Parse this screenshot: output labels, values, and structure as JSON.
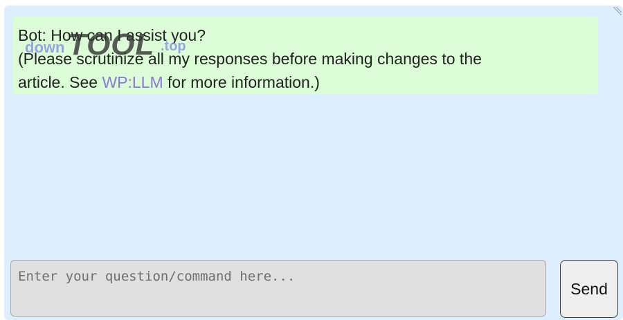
{
  "chat": {
    "messages": [
      {
        "line1": "Bot: How can I assist you?",
        "line2": "(Please scrutinize all my responses before making changes to the",
        "line3_prefix": "article. See ",
        "line3_link": "WP:LLM",
        "line3_suffix": " for more information.)"
      }
    ]
  },
  "watermark": {
    "down": "down",
    "tool": "TOOL",
    "top": ".top"
  },
  "composer": {
    "placeholder": "Enter your question/command here...",
    "value": "",
    "send_label": "Send"
  },
  "colors": {
    "panel_background": "#ddeeff",
    "bot_bubble": "#dcfcd7",
    "link": "#8a79d6",
    "input_background": "#e0e0e0"
  },
  "icons": {
    "resize": "resize-grip-icon"
  }
}
